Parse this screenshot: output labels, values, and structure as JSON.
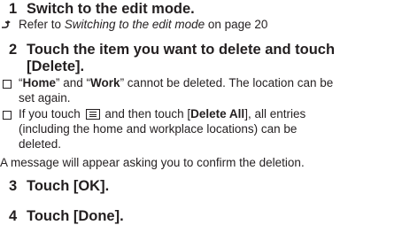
{
  "steps": [
    {
      "num": "1",
      "text": "Switch to the edit mode."
    },
    {
      "num": "2",
      "text_line1": "Touch the item you want to delete and touch",
      "text_line2": "[Delete]."
    },
    {
      "num": "3",
      "text": "Touch [OK]."
    },
    {
      "num": "4",
      "text": "Touch [Done]."
    }
  ],
  "reference": {
    "prefix": "Refer to ",
    "link": "Switching to the edit mode",
    "suffix": " on page 20"
  },
  "note1": {
    "q1": "“",
    "home": "Home",
    "mid": "” and “",
    "work": "Work",
    "rest": "” cannot be deleted. The location can be",
    "line2": "set again."
  },
  "note2": {
    "pre": "If you touch",
    "post": "and then touch [",
    "delete_all": "Delete All",
    "end": "], all entries",
    "line2": "(including the home and workplace locations) can be",
    "line3": "deleted."
  },
  "message": "A message will appear asking you to confirm the deletion.",
  "icons": {
    "reference_arrow": "arrow-right-icon",
    "note_bullet": "square-bullet-icon",
    "menu": "menu-icon"
  }
}
